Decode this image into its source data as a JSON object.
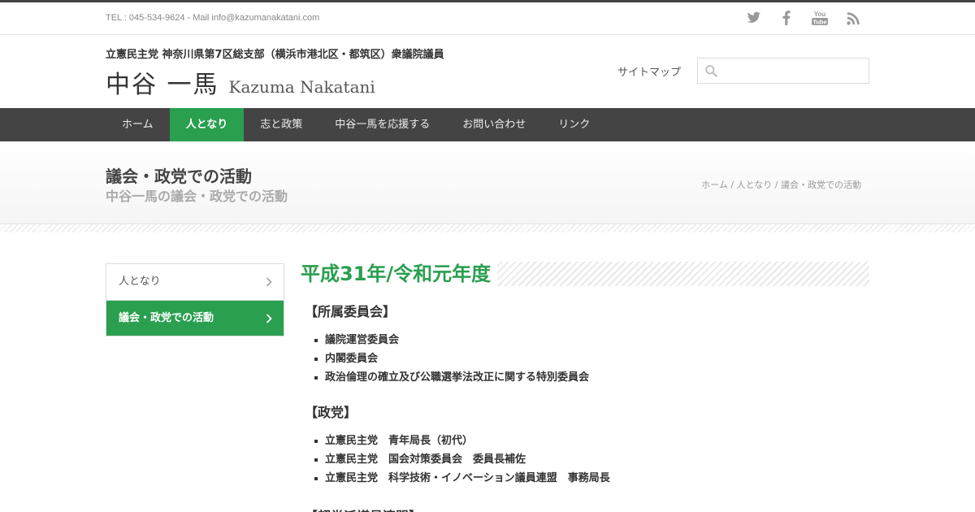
{
  "topbar": {
    "contact": "TEL : 045-534-9624 - Mail info@kazumanakatani.com",
    "social": [
      "twitter-icon",
      "facebook-icon",
      "youtube-icon",
      "rss-icon"
    ],
    "youtube_text": "You Tube"
  },
  "header": {
    "tagline": "立憲民主党 神奈川県第7区総支部（横浜市港北区・都筑区）衆議院議員",
    "logo_jp": "中谷 一馬",
    "logo_en": "Kazuma Nakatani",
    "sitemap": "サイトマップ",
    "search_value": ""
  },
  "nav": {
    "items": [
      "ホーム",
      "人となり",
      "志と政策",
      "中谷一馬を応援する",
      "お問い合わせ",
      "リンク"
    ],
    "active": "人となり"
  },
  "page": {
    "title": "議会・政党での活動",
    "subtitle": "中谷一馬の議会・政党での活動",
    "breadcrumb": "ホーム / 人となり / 議会・政党での活動"
  },
  "sidebar": {
    "items": [
      "人となり",
      "議会・政党での活動"
    ],
    "active": "議会・政党での活動"
  },
  "content": {
    "year": "平成31年/令和元年度",
    "sections": [
      {
        "title": "【所属委員会】",
        "items": [
          "議院運営委員会",
          "内閣委員会",
          "政治倫理の確立及び公職選挙法改正に関する特別委員会"
        ]
      },
      {
        "title": "【政党】",
        "items": [
          "立憲民主党　青年局長（初代）",
          "立憲民主党　国会対策委員会　委員長補佐",
          "立憲民主党　科学技術・イノベーション議員連盟　事務局長"
        ]
      }
    ],
    "partial_next": "【超党派議員連盟】"
  },
  "colors": {
    "accent": "#2a9f4f",
    "nav_bg": "#444444"
  }
}
